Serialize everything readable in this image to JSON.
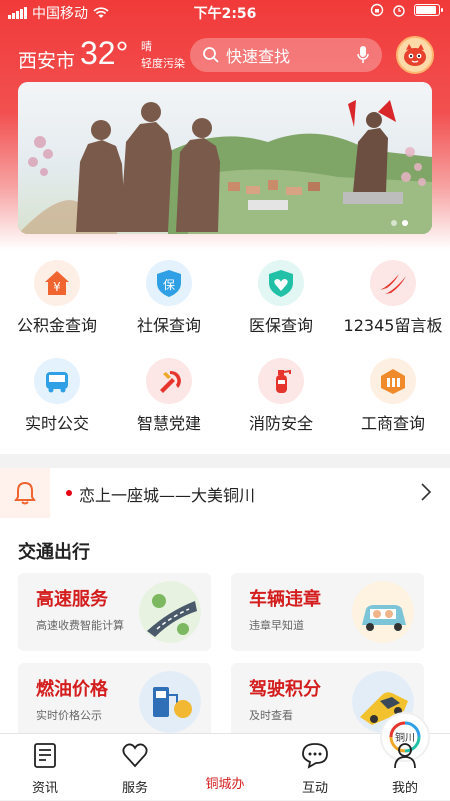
{
  "status_bar": {
    "carrier": "中国移动",
    "time": "下午2:56",
    "battery_level": 0.9
  },
  "header": {
    "city": "西安市",
    "temperature": "32°",
    "weather": "晴",
    "air_quality": "轻度污染",
    "search_placeholder": "快速查找"
  },
  "banner": {
    "page_count": 2,
    "active_page": 2
  },
  "services": [
    {
      "label": "公积金查询",
      "icon": "housing-fund-icon",
      "color": "#f0642f"
    },
    {
      "label": "社保查询",
      "icon": "social-insurance-icon",
      "color": "#2f9fe6"
    },
    {
      "label": "医保查询",
      "icon": "medical-insurance-icon",
      "color": "#23c0a8"
    },
    {
      "label": "12345留言板",
      "icon": "hotline-icon",
      "color": "#e6352d"
    },
    {
      "label": "实时公交",
      "icon": "bus-icon",
      "color": "#2f9fe6"
    },
    {
      "label": "智慧党建",
      "icon": "party-icon",
      "color": "#e6352d"
    },
    {
      "label": "消防安全",
      "icon": "fire-extinguisher-icon",
      "color": "#e6352d"
    },
    {
      "label": "工商查询",
      "icon": "commerce-icon",
      "color": "#f08a2a"
    }
  ],
  "news": {
    "text": "恋上一座城——大美铜川"
  },
  "transport": {
    "title": "交通出行",
    "cards": [
      {
        "title": "高速服务",
        "subtitle": "高速收费智能计算",
        "icon": "highway-icon"
      },
      {
        "title": "车辆违章",
        "subtitle": "违章早知道",
        "icon": "car-violation-icon"
      },
      {
        "title": "燃油价格",
        "subtitle": "实时价格公示",
        "icon": "fuel-price-icon"
      },
      {
        "title": "驾驶积分",
        "subtitle": "及时查看",
        "icon": "driving-score-icon"
      }
    ]
  },
  "tabbar": {
    "items": [
      {
        "label": "资讯",
        "icon": "news-icon"
      },
      {
        "label": "服务",
        "icon": "heart-icon"
      },
      {
        "label": "铜城办",
        "icon": "tongcheng-logo-icon",
        "logo_text": "铜川",
        "active": true
      },
      {
        "label": "互动",
        "icon": "chat-icon"
      },
      {
        "label": "我的",
        "icon": "user-icon"
      }
    ]
  },
  "colors": {
    "brand_red": "#f13a3a",
    "accent_red": "#d41e1e"
  }
}
